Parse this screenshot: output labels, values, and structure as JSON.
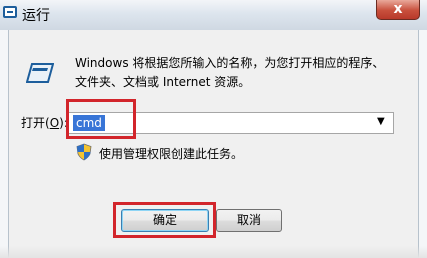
{
  "window": {
    "title": "运行",
    "icon": "run-dialog-icon",
    "close_label": "x"
  },
  "dialog": {
    "icon": "run-icon",
    "description_line1": "Windows 将根据您所输入的名称，为您打开相应的程序、",
    "description_line2": "文件夹、文档或 Internet 资源。",
    "open_label_prefix": "打开(",
    "open_label_accel": "O",
    "open_label_suffix": "):",
    "open_value": "cmd",
    "admin_icon": "uac-shield-icon",
    "admin_note": "使用管理权限创建此任务。"
  },
  "buttons": {
    "ok_label": "确定",
    "cancel_label": "取消"
  },
  "colors": {
    "highlight_box": "#d2252b",
    "selection": "#3875d7"
  }
}
